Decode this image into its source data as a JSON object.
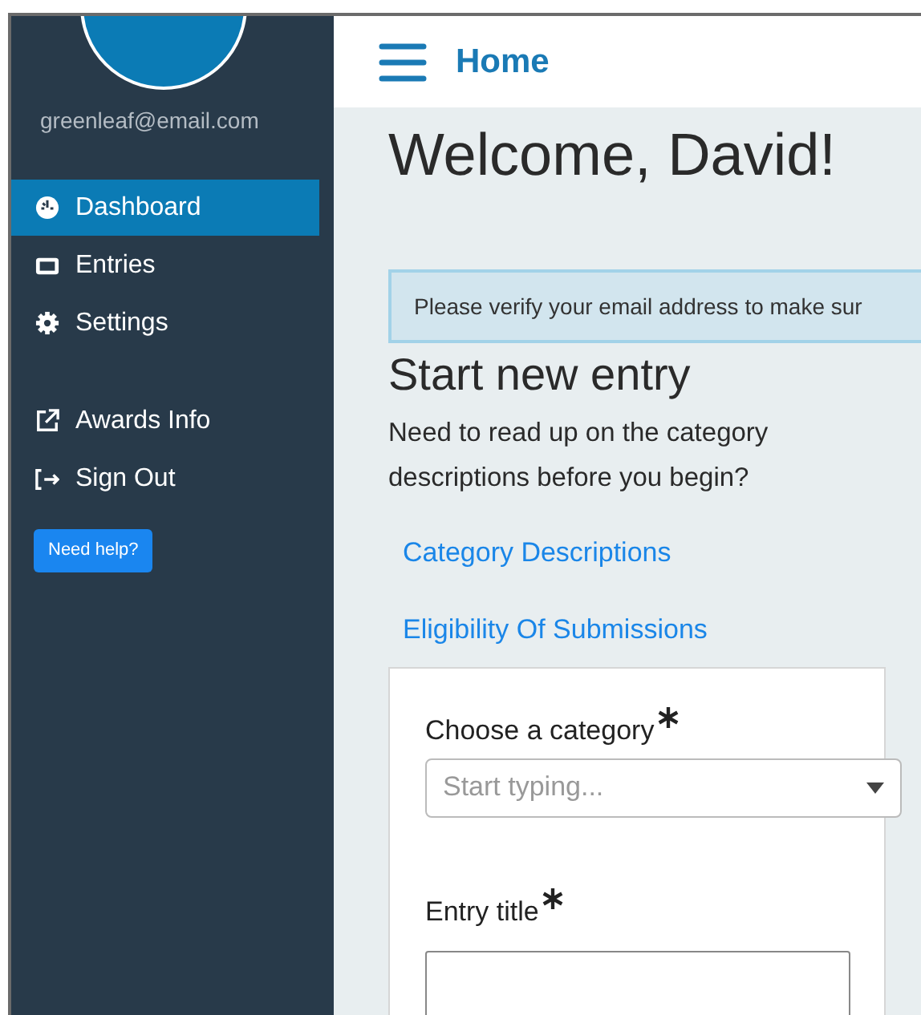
{
  "sidebar": {
    "email": "greenleaf@email.com",
    "items": [
      {
        "label": "Dashboard",
        "kind": "dashboard",
        "selected": true
      },
      {
        "label": "Entries",
        "kind": "entries",
        "selected": false
      },
      {
        "label": "Settings",
        "kind": "settings",
        "selected": false
      },
      {
        "label": "Awards Info",
        "kind": "external",
        "selected": false
      },
      {
        "label": "Sign Out",
        "kind": "signout",
        "selected": false
      }
    ],
    "help_button": "Need help?"
  },
  "header": {
    "title": "Home"
  },
  "welcome": "Welcome, David!",
  "alert": "Please verify your email address to make sur",
  "section": {
    "title": "Start new entry",
    "text": "Need to read up on the category descriptions before you begin?",
    "links": [
      "Category Descriptions",
      "Eligibility Of Submissions"
    ]
  },
  "form": {
    "fields": [
      {
        "kind": "select",
        "label": "Choose a category",
        "required": true,
        "placeholder": "Start typing..."
      },
      {
        "kind": "text",
        "label": "Entry title",
        "required": true
      }
    ]
  }
}
